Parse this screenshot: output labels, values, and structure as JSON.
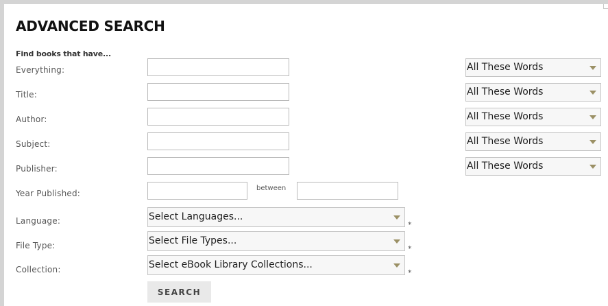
{
  "page": {
    "title": "ADVANCED SEARCH",
    "subtitle": "Find books that have..."
  },
  "fields": [
    {
      "label": "Everything:",
      "value": "",
      "mode": "All These Words"
    },
    {
      "label": "Title:",
      "value": "",
      "mode": "All These Words"
    },
    {
      "label": "Author:",
      "value": "",
      "mode": "All These Words"
    },
    {
      "label": "Subject:",
      "value": "",
      "mode": "All These Words"
    },
    {
      "label": "Publisher:",
      "value": "",
      "mode": "All These Words"
    }
  ],
  "year": {
    "label": "Year Published:",
    "from_value": "",
    "between_label": "between",
    "to_value": ""
  },
  "language": {
    "label": "Language:",
    "selected": "Select Languages...",
    "required_mark": "*"
  },
  "file_type": {
    "label": "File Type:",
    "selected": "Select File Types...",
    "required_mark": "*"
  },
  "collection": {
    "label": "Collection:",
    "selected": "Select eBook Library Collections...",
    "required_mark": "*"
  },
  "search_button": {
    "label": "SEARCH"
  },
  "colors": {
    "caret": "#9b9065",
    "button_bg": "#e9e9e9",
    "border": "#b9b9b9"
  },
  "icons": {
    "dropdown": "chevron-down-icon"
  }
}
